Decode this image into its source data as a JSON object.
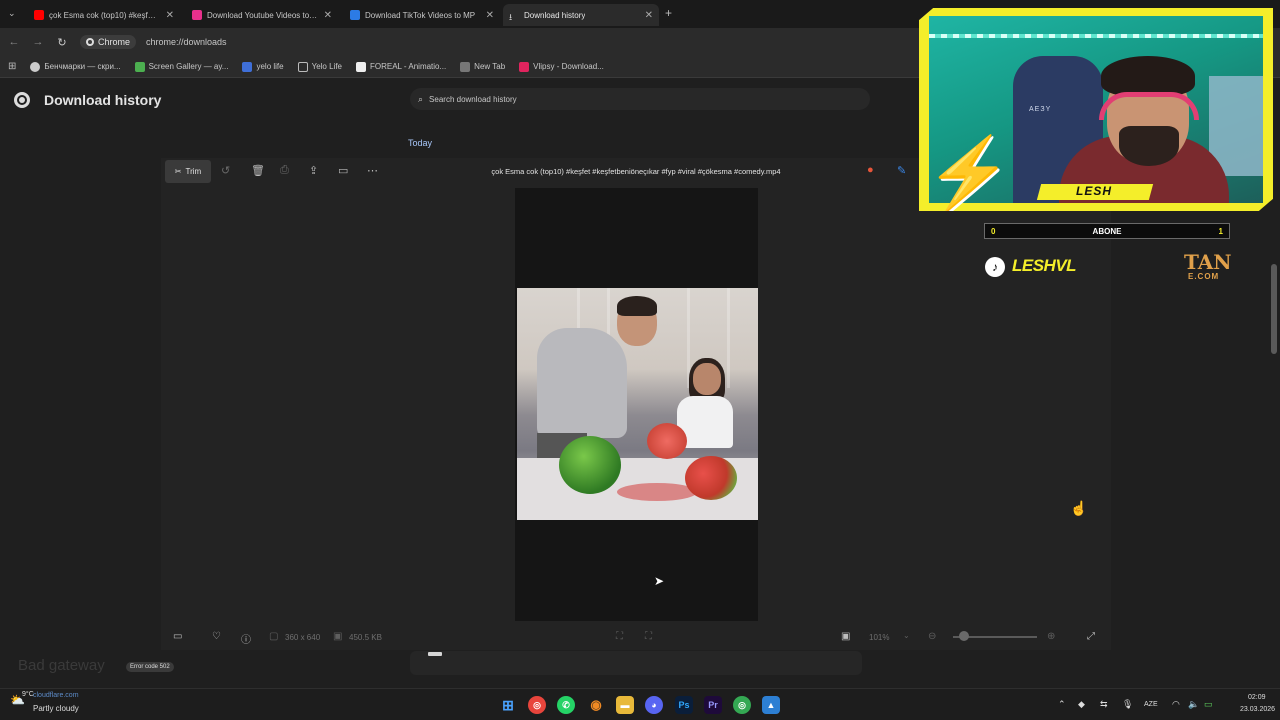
{
  "browser": {
    "tabs": [
      {
        "title": "çok Esma cok (top10) #keşfet #",
        "favicon_color": "#ff0000",
        "active": false
      },
      {
        "title": "Download Youtube Videos to M",
        "favicon_color": "#e9308c",
        "active": false
      },
      {
        "title": "Download TikTok Videos to MP",
        "favicon_color": "#2c7be5",
        "active": false
      },
      {
        "title": "Download history",
        "favicon_color": "#c7c7c7",
        "active": true
      }
    ],
    "new_tab_symbol": "+",
    "omnibox": {
      "chip_label": "Chrome",
      "url": "chrome://downloads"
    },
    "bookmarks": [
      {
        "label": "Бенчмарки — скри...",
        "color": "#cccccc"
      },
      {
        "label": "Screen Gallery — ay...",
        "color": "#4caf50"
      },
      {
        "label": "yelo life",
        "color": "#3f6fd8"
      },
      {
        "label": "Yelo Life",
        "color": "#bdbdbd"
      },
      {
        "label": "FOREAL - Animatio...",
        "color": "#eeeeee"
      },
      {
        "label": "New Tab",
        "color": "#777777"
      },
      {
        "label": "Vlipsy - Download...",
        "color": "#e0245e"
      }
    ]
  },
  "downloads": {
    "title": "Download history",
    "search_placeholder": "Search download history",
    "section_label": "Today"
  },
  "viewer": {
    "trim_label": "Trim",
    "filename": "çok Esma cok (top10) #keşfet #keşfetbeniöneçıkar #fyp⁣ #viral #çökesma #comedy.mp4",
    "dimensions": "360 x 640",
    "file_size": "450.5 KB",
    "zoom": "101%"
  },
  "stream_overlay": {
    "cam_name": "LESH",
    "chair_brand": "AEЗY",
    "sub_goal_left": "0",
    "sub_goal_label": "ABONE",
    "sub_goal_right": "1",
    "tiktok_handle": "LESHVL",
    "sponsor_top": "TAN",
    "sponsor_bottom": "E.COM"
  },
  "background_page": {
    "bad_gateway": "Bad gateway",
    "error_code": "Error code 502"
  },
  "taskbar": {
    "weather_temp": "9°C",
    "weather_desc": "Partly cloudy",
    "cloudflare_url": "cloudflare.com",
    "language": "AZE",
    "time": "02:09",
    "date": "23.03.2026"
  }
}
